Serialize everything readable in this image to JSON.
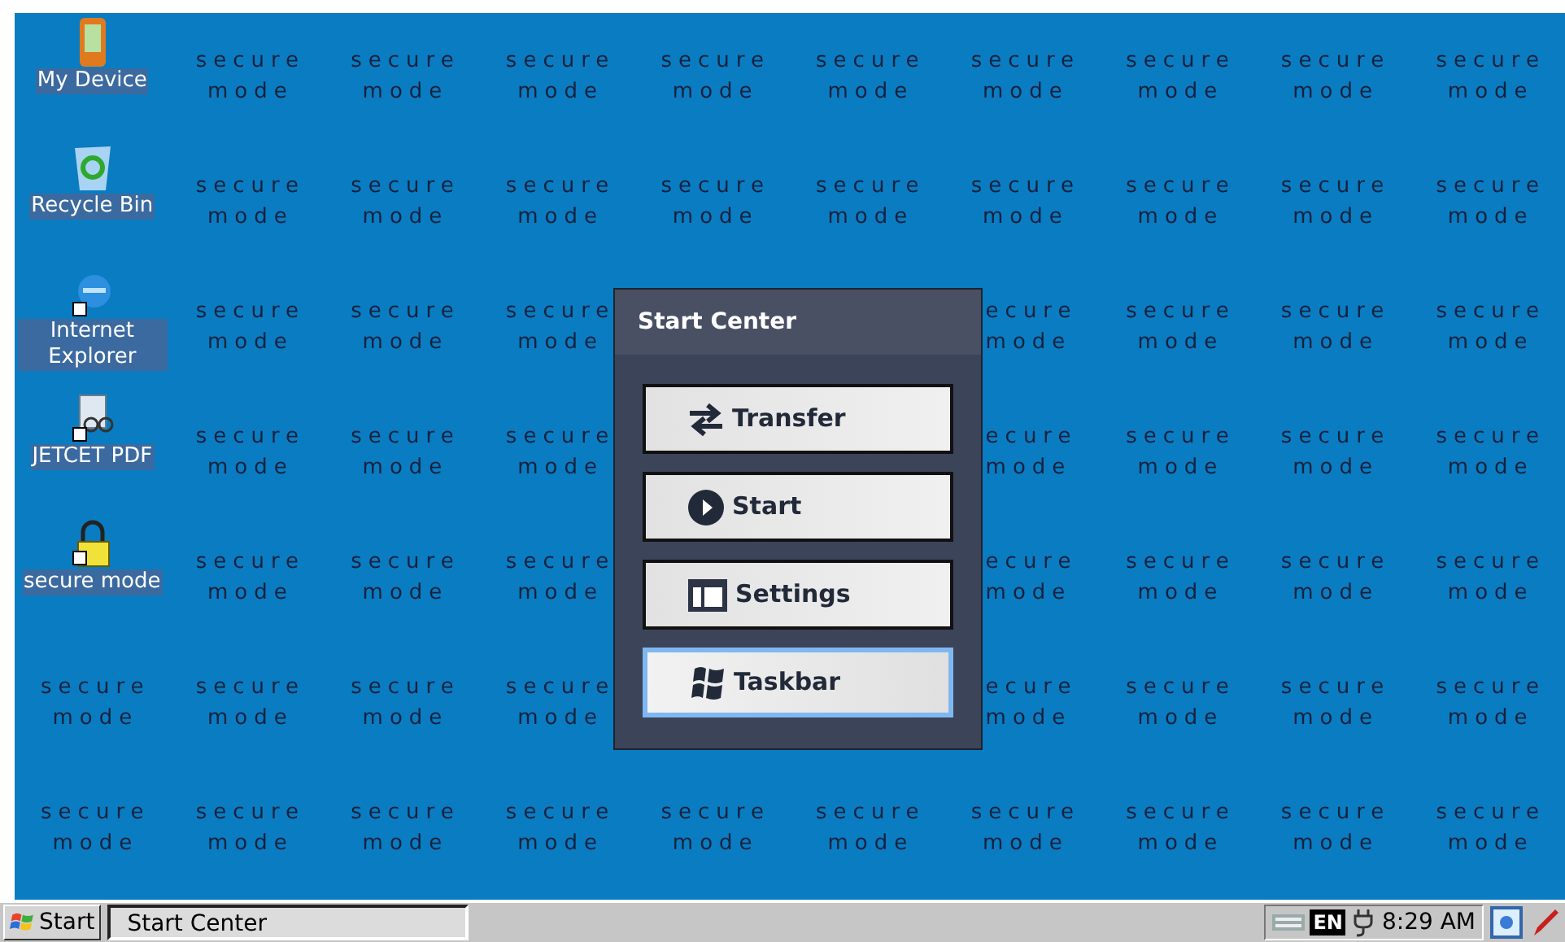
{
  "desktop_icons": [
    {
      "kind": "device",
      "label": "My Device"
    },
    {
      "kind": "recycle",
      "label": "Recycle Bin"
    },
    {
      "kind": "browser",
      "label": "Internet Explorer"
    },
    {
      "kind": "pdf",
      "label": "JETCET PDF"
    },
    {
      "kind": "lock",
      "label": "secure mode"
    }
  ],
  "wallpaper": {
    "rows": [
      [
        {
          "kind": "icon"
        },
        {
          "kind": "full",
          "line_1": "secure",
          "line_2": "mode"
        },
        {
          "kind": "full",
          "line_1": "secure",
          "line_2": "mode"
        },
        {
          "kind": "full",
          "line_1": "secure",
          "line_2": "mode"
        },
        {
          "kind": "full",
          "line_1": "secure",
          "line_2": "mode"
        },
        {
          "kind": "full",
          "line_1": "secure",
          "line_2": "mode"
        },
        {
          "kind": "full",
          "line_1": "secure",
          "line_2": "mode"
        },
        {
          "kind": "full",
          "line_1": "secure",
          "line_2": "mode"
        },
        {
          "kind": "full",
          "line_1": "secure",
          "line_2": "mode"
        },
        {
          "kind": "full",
          "line_1": "secure",
          "line_2": "mode"
        }
      ],
      [
        {
          "kind": "icon"
        },
        {
          "kind": "full",
          "line_1": "secure",
          "line_2": "mode"
        },
        {
          "kind": "full",
          "line_1": "secure",
          "line_2": "mode"
        },
        {
          "kind": "full",
          "line_1": "secure",
          "line_2": "mode"
        },
        {
          "kind": "full",
          "line_1": "secure",
          "line_2": "mode"
        },
        {
          "kind": "full",
          "line_1": "secure",
          "line_2": "mode"
        },
        {
          "kind": "full",
          "line_1": "secure",
          "line_2": "mode"
        },
        {
          "kind": "full",
          "line_1": "secure",
          "line_2": "mode"
        },
        {
          "kind": "full",
          "line_1": "secure",
          "line_2": "mode"
        },
        {
          "kind": "full",
          "line_1": "secure",
          "line_2": "mode"
        }
      ],
      [
        {
          "kind": "icon"
        },
        {
          "kind": "full",
          "line_1": "secure",
          "line_2": "mode"
        },
        {
          "kind": "full",
          "line_1": "secure",
          "line_2": "mode"
        },
        {
          "kind": "full",
          "line_1": "secure",
          "line_2": "mode"
        },
        {
          "kind": "hidden"
        },
        {
          "kind": "hidden"
        },
        {
          "kind": "cut",
          "line_1": "ecure",
          "line_2": "mode"
        },
        {
          "kind": "full",
          "line_1": "secure",
          "line_2": "mode"
        },
        {
          "kind": "full",
          "line_1": "secure",
          "line_2": "mode"
        },
        {
          "kind": "full",
          "line_1": "secure",
          "line_2": "mode"
        }
      ],
      [
        {
          "kind": "icon"
        },
        {
          "kind": "full",
          "line_1": "secure",
          "line_2": "mode"
        },
        {
          "kind": "full",
          "line_1": "secure",
          "line_2": "mode"
        },
        {
          "kind": "full",
          "line_1": "secure",
          "line_2": "mode"
        },
        {
          "kind": "hidden"
        },
        {
          "kind": "hidden"
        },
        {
          "kind": "cut",
          "line_1": "ecure",
          "line_2": "mode"
        },
        {
          "kind": "full",
          "line_1": "secure",
          "line_2": "mode"
        },
        {
          "kind": "full",
          "line_1": "secure",
          "line_2": "mode"
        },
        {
          "kind": "full",
          "line_1": "secure",
          "line_2": "mode"
        }
      ],
      [
        {
          "kind": "icon"
        },
        {
          "kind": "full",
          "line_1": "secure",
          "line_2": "mode"
        },
        {
          "kind": "full",
          "line_1": "secure",
          "line_2": "mode"
        },
        {
          "kind": "full",
          "line_1": "secure",
          "line_2": "mode"
        },
        {
          "kind": "hidden"
        },
        {
          "kind": "hidden"
        },
        {
          "kind": "cut",
          "line_1": "ecure",
          "line_2": "mode"
        },
        {
          "kind": "full",
          "line_1": "secure",
          "line_2": "mode"
        },
        {
          "kind": "full",
          "line_1": "secure",
          "line_2": "mode"
        },
        {
          "kind": "full",
          "line_1": "secure",
          "line_2": "mode"
        }
      ],
      [
        {
          "kind": "full",
          "line_1": "secure",
          "line_2": "mode"
        },
        {
          "kind": "full",
          "line_1": "secure",
          "line_2": "mode"
        },
        {
          "kind": "full",
          "line_1": "secure",
          "line_2": "mode"
        },
        {
          "kind": "full",
          "line_1": "secure",
          "line_2": "mode"
        },
        {
          "kind": "hidden"
        },
        {
          "kind": "hidden"
        },
        {
          "kind": "cut",
          "line_1": "ecure",
          "line_2": "mode"
        },
        {
          "kind": "full",
          "line_1": "secure",
          "line_2": "mode"
        },
        {
          "kind": "full",
          "line_1": "secure",
          "line_2": "mode"
        },
        {
          "kind": "full",
          "line_1": "secure",
          "line_2": "mode"
        }
      ],
      [
        {
          "kind": "full",
          "line_1": "secure",
          "line_2": "mode"
        },
        {
          "kind": "full",
          "line_1": "secure",
          "line_2": "mode"
        },
        {
          "kind": "full",
          "line_1": "secure",
          "line_2": "mode"
        },
        {
          "kind": "full",
          "line_1": "secure",
          "line_2": "mode"
        },
        {
          "kind": "full",
          "line_1": "secure",
          "line_2": "mode"
        },
        {
          "kind": "full",
          "line_1": "secure",
          "line_2": "mode"
        },
        {
          "kind": "full",
          "line_1": "secure",
          "line_2": "mode"
        },
        {
          "kind": "full",
          "line_1": "secure",
          "line_2": "mode"
        },
        {
          "kind": "full",
          "line_1": "secure",
          "line_2": "mode"
        },
        {
          "kind": "full",
          "line_1": "secure",
          "line_2": "mode"
        }
      ]
    ]
  },
  "dialog": {
    "title": "Start Center",
    "buttons": [
      {
        "kind": "transfer",
        "label": "Transfer",
        "selected": false
      },
      {
        "kind": "play",
        "label": "Start",
        "selected": false
      },
      {
        "kind": "settings",
        "label": "Settings",
        "selected": false
      },
      {
        "kind": "windows",
        "label": "Taskbar",
        "selected": true
      }
    ]
  },
  "taskbar": {
    "start_label": "Start",
    "tasks": [
      {
        "label": "Start Center",
        "selected": true
      }
    ],
    "language": "EN",
    "clock": "8:29 AM"
  }
}
